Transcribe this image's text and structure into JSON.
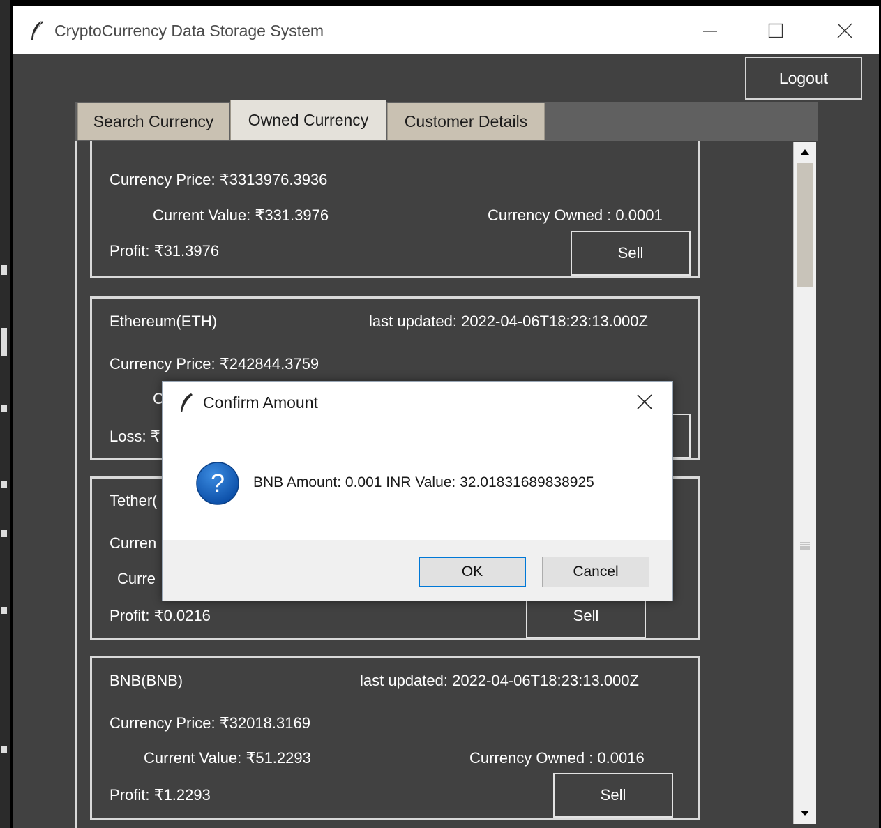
{
  "window": {
    "title": "CryptoCurrency Data Storage System"
  },
  "toolbar": {
    "logout_label": "Logout"
  },
  "tabs": [
    {
      "label": "Search Currency"
    },
    {
      "label": "Owned Currency"
    },
    {
      "label": "Customer Details"
    }
  ],
  "cards": [
    {
      "price": "Currency Price: ₹3313976.3936",
      "current_value": "Current Value: ₹331.3976",
      "owned": "Currency Owned : 0.0001",
      "profit": "Profit: ₹31.3976",
      "sell_label": "Sell"
    },
    {
      "name": "Ethereum(ETH)",
      "last_updated": "last updated: 2022-04-06T18:23:13.000Z",
      "price": "Currency Price: ₹242844.3759",
      "current_value_partial": "C",
      "loss_partial": "Loss: ₹"
    },
    {
      "name_partial": "Tether(",
      "price_partial": "Curren",
      "current_value_partial": "Curre",
      "profit": "Profit: ₹0.0216",
      "sell_label": "Sell"
    },
    {
      "name": "BNB(BNB)",
      "last_updated": "last updated: 2022-04-06T18:23:13.000Z",
      "price": "Currency Price: ₹32018.3169",
      "current_value": "Current Value: ₹51.2293",
      "owned": "Currency Owned : 0.0016",
      "profit": "Profit: ₹1.2293",
      "sell_label": "Sell"
    }
  ],
  "dialog": {
    "title": "Confirm Amount",
    "message": "BNB Amount: 0.001 INR Value: 32.01831689838925",
    "ok_label": "OK",
    "cancel_label": "Cancel",
    "icon": "question-icon"
  },
  "colors": {
    "window_bg": "#414141",
    "tab_bg": "#c9c1b2",
    "active_tab_bg": "#e4e1da",
    "card_border": "#d9d9d9",
    "ok_border": "#0078d7",
    "question_icon": "#1565c0"
  }
}
